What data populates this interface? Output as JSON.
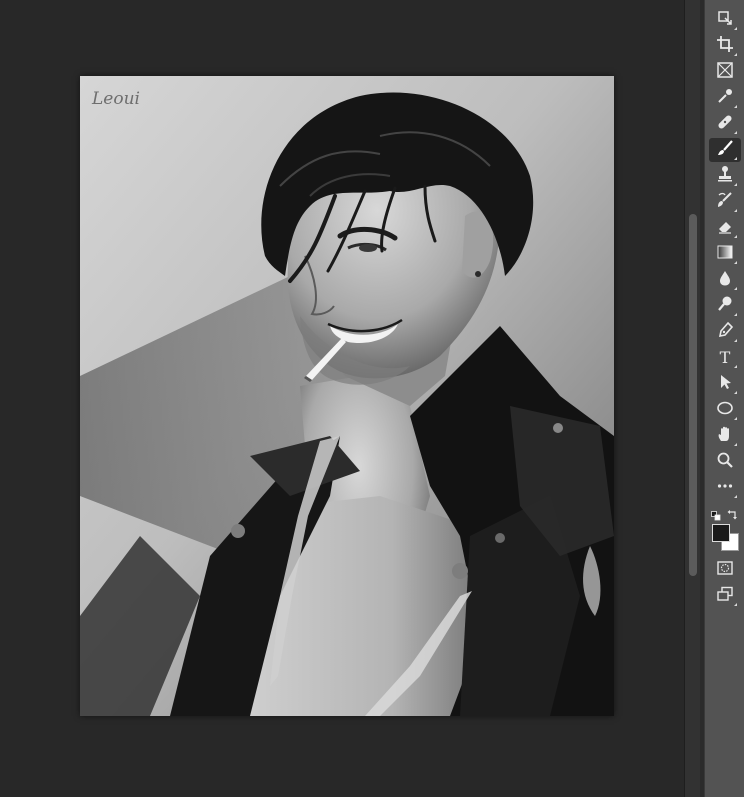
{
  "canvas": {
    "signature_text": "Leoui"
  },
  "toolbar": {
    "tools": [
      {
        "id": "artboard",
        "icon": "artboard-icon"
      },
      {
        "id": "crop",
        "icon": "crop-icon"
      },
      {
        "id": "frame",
        "icon": "frame-icon"
      },
      {
        "id": "eyedropper",
        "icon": "eyedropper-icon"
      },
      {
        "id": "healing",
        "icon": "bandage-icon"
      },
      {
        "id": "brush",
        "icon": "brush-icon",
        "active": true
      },
      {
        "id": "clone-stamp",
        "icon": "stamp-icon"
      },
      {
        "id": "history-brush",
        "icon": "history-brush-icon"
      },
      {
        "id": "eraser",
        "icon": "eraser-icon"
      },
      {
        "id": "gradient",
        "icon": "gradient-icon"
      },
      {
        "id": "blur",
        "icon": "droplet-icon"
      },
      {
        "id": "dodge",
        "icon": "dodge-icon"
      },
      {
        "id": "pen",
        "icon": "pen-icon"
      },
      {
        "id": "type",
        "icon": "type-icon",
        "label": "T"
      },
      {
        "id": "path-selection",
        "icon": "arrow-icon"
      },
      {
        "id": "ellipse",
        "icon": "ellipse-icon"
      },
      {
        "id": "hand",
        "icon": "hand-icon"
      },
      {
        "id": "zoom",
        "icon": "zoom-icon"
      },
      {
        "id": "more-tools",
        "icon": "more-icon"
      }
    ],
    "foreground_color": "#1a1a1a",
    "background_color": "#ffffff"
  },
  "colors": {
    "workspace_bg": "#282828",
    "toolbar_bg": "#535353",
    "active_tool_bg": "#2f2f2f"
  }
}
